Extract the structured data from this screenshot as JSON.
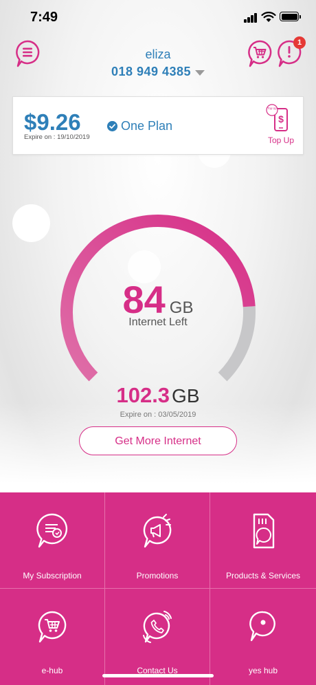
{
  "status_bar": {
    "time": "7:49"
  },
  "header": {
    "user_name": "eliza",
    "phone_number": "018 949 4385",
    "alert_badge_count": "1",
    "icons": [
      "menu-icon",
      "cart-icon",
      "alert-icon"
    ]
  },
  "balance_card": {
    "amount": "$9.26",
    "expire_label": "Expire on : ",
    "expire_date": "19/10/2019",
    "plan_name": "One Plan",
    "topup_label": "Top Up",
    "topup_phone_text": "Top Up"
  },
  "usage": {
    "remaining_value": "84",
    "remaining_unit": "GB",
    "remaining_caption": "Internet Left",
    "total_value": "102.3",
    "total_unit": "GB",
    "expire_text": "Expire on : 03/05/2019",
    "remaining_fraction": 0.82,
    "get_more_label": "Get More Internet"
  },
  "colors": {
    "accent": "#d62e87",
    "brand_blue": "#2e7fb8",
    "gauge_track": "#c7c7c9",
    "badge_red": "#e53935"
  },
  "menu": [
    {
      "label": "My Subscription",
      "icon": "subscription-icon"
    },
    {
      "label": "Promotions",
      "icon": "megaphone-icon"
    },
    {
      "label": "Products & Services",
      "icon": "sim-card-icon"
    },
    {
      "label": "e-hub",
      "icon": "cart-icon"
    },
    {
      "label": "Contact Us",
      "icon": "phone-icon"
    },
    {
      "label": "yes hub",
      "icon": "location-pin-icon"
    }
  ]
}
